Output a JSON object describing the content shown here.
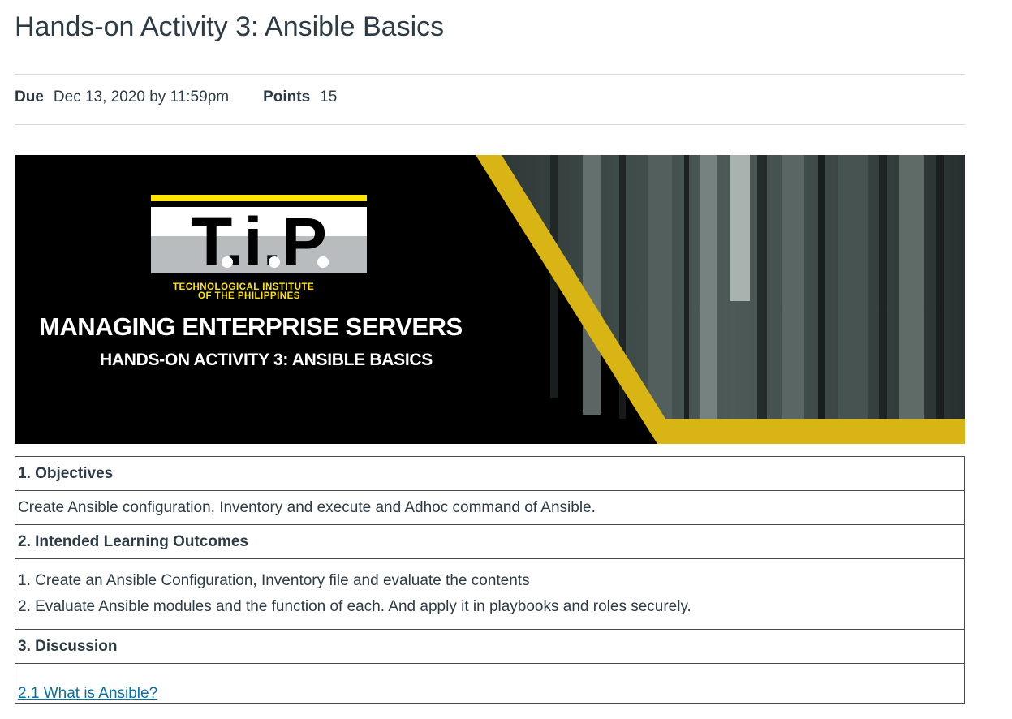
{
  "assignment": {
    "title": "Hands-on Activity 3: Ansible Basics",
    "due_label": "Due",
    "due_value": "Dec 13, 2020 by 11:59pm",
    "points_label": "Points",
    "points_value": "15"
  },
  "banner": {
    "logo_text": "T.i.P",
    "institution_line1": "TECHNOLOGICAL INSTITUTE",
    "institution_line2": "OF THE PHILIPPINES",
    "course": "MANAGING ENTERPRISE SERVERS",
    "activity": "HANDS-ON ACTIVITY 3: ANSIBLE BASICS",
    "colors": {
      "background": "#000000",
      "accent": "#d8b514",
      "logo_yellow": "#ffe500"
    }
  },
  "sections": {
    "objectives_heading": "1. Objectives",
    "objectives_text": "Create Ansible configuration, Inventory and execute and Adhoc command of Ansible.",
    "ilo_heading": "2. Intended Learning Outcomes",
    "ilo_items": [
      "1. Create an Ansible Configuration, Inventory file and evaluate the contents",
      "2. Evaluate Ansible modules and the function of each. And apply it in playbooks and roles securely."
    ],
    "discussion_heading": "3. Discussion",
    "discussion_link": "2.1 What is Ansible?"
  },
  "colors": {
    "link": "#0770a3",
    "text": "#2d3b45",
    "rule": "#d7dadd"
  }
}
